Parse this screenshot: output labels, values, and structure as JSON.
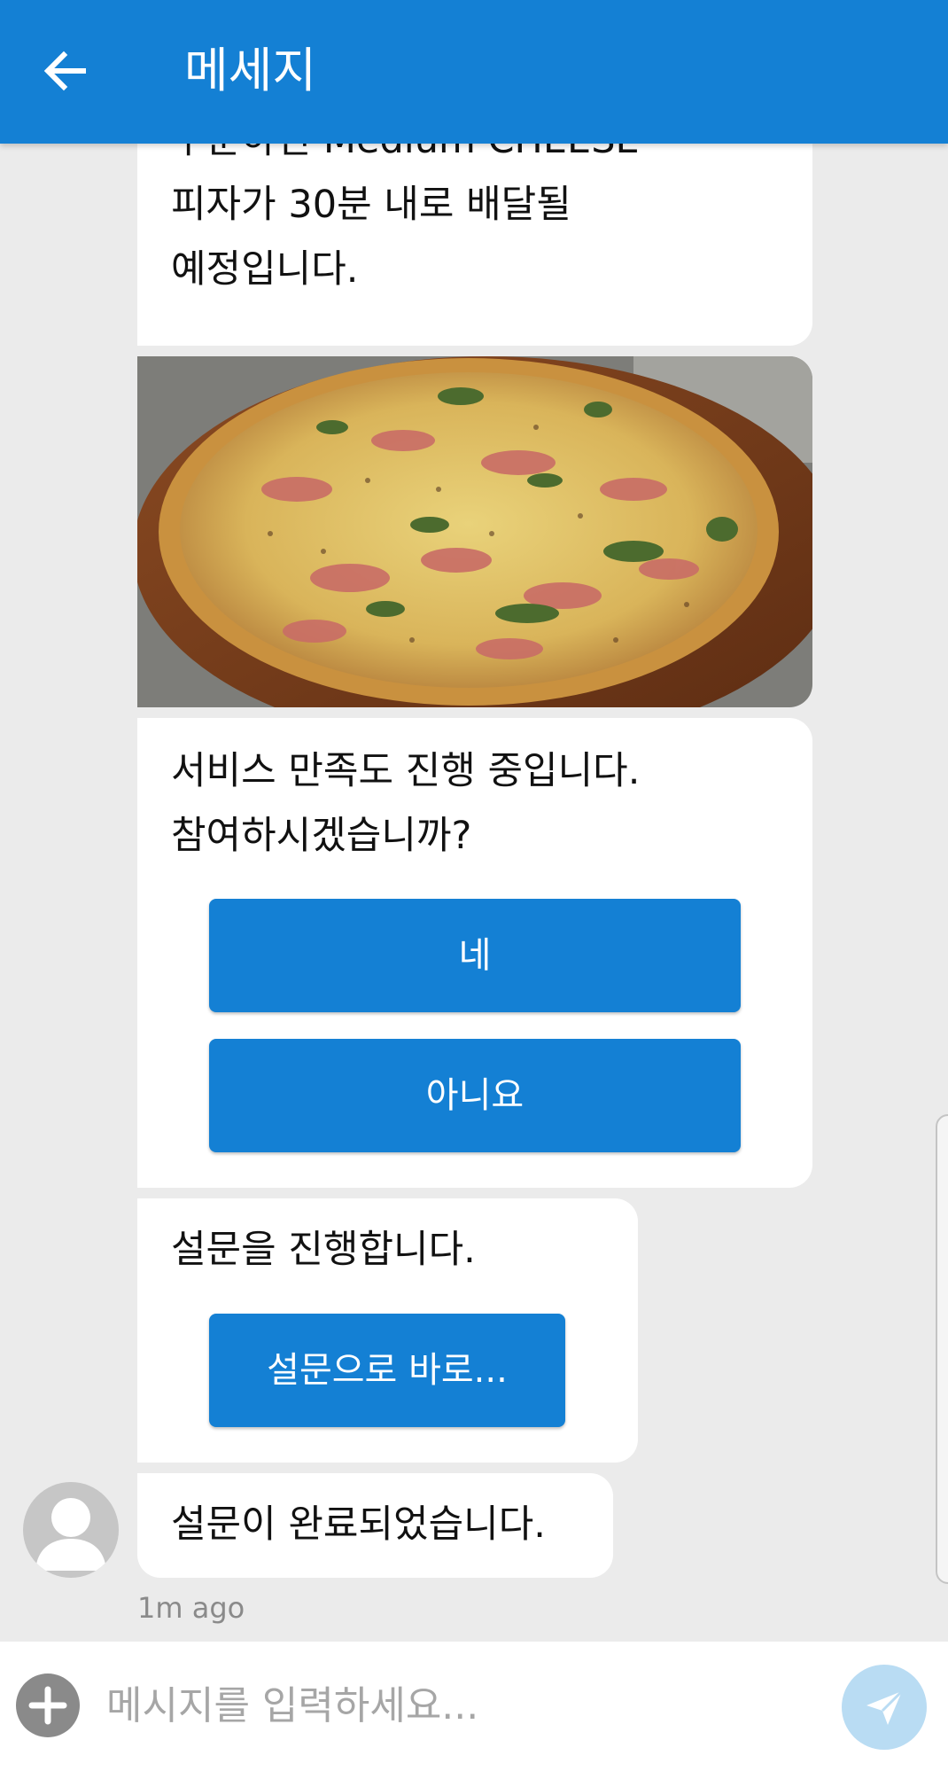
{
  "header": {
    "title": "메세지",
    "back_icon": "arrow-left-icon"
  },
  "messages": [
    {
      "type": "text",
      "lines": [
        "주문하신 Medium CHEESE",
        "피자가 30분 내로 배달될",
        "예정입니다."
      ]
    },
    {
      "type": "image",
      "subject": "pizza"
    },
    {
      "type": "prompt",
      "lines": [
        "서비스 만족도 진행 중입니다.",
        "참여하시겠습니까?"
      ],
      "buttons": [
        "네",
        "아니요"
      ]
    },
    {
      "type": "prompt",
      "lines": [
        "설문을 진행합니다."
      ],
      "buttons": [
        "설문으로 바로..."
      ]
    },
    {
      "type": "text",
      "lines": [
        "설문이 완료되었습니다."
      ],
      "timestamp": "1m ago"
    }
  ],
  "composer": {
    "placeholder": "메시지를 입력하세요...",
    "add_icon": "plus-circle-icon",
    "send_icon": "send-icon"
  },
  "colors": {
    "primary": "#1480d4",
    "background": "#ebebeb",
    "bubble": "#ffffff",
    "send_button": "#b9dcf3"
  }
}
